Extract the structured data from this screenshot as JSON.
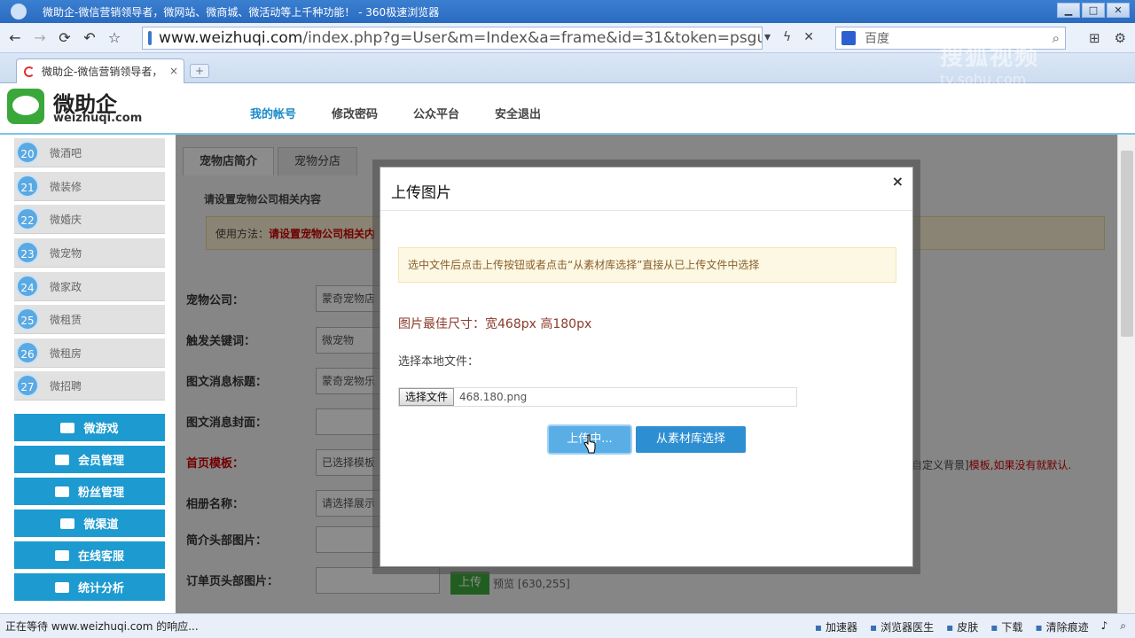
{
  "window": {
    "title": "微助企-微信营销领导者，微网站、微商城、微活动等上千种功能！ - 360极速浏览器"
  },
  "browser": {
    "url_host": "www.weizhuqi.com",
    "url_path": "/index.php?g=User&m=Index&a=frame&id=31&token=psguai1",
    "search_placeholder": "百度",
    "tab_title": "微助企-微信营销领导者，",
    "status_text": "正在等待 www.weizhuqi.com 的响应...",
    "status_tools": [
      "加速器",
      "浏览器医生",
      "皮肤",
      "下载",
      "清除痕迹"
    ],
    "watermark": "搜狐视频",
    "watermark_sub": "tv.sohu.com"
  },
  "header": {
    "logo_title": "微助企",
    "logo_sub": "weizhuqi.com",
    "menu": [
      "我的帐号",
      "修改密码",
      "公众平台",
      "安全退出"
    ]
  },
  "sidebar": {
    "items": [
      {
        "num": "20",
        "label": "微酒吧"
      },
      {
        "num": "21",
        "label": "微装修"
      },
      {
        "num": "22",
        "label": "微婚庆"
      },
      {
        "num": "23",
        "label": "微宠物"
      },
      {
        "num": "24",
        "label": "微家政"
      },
      {
        "num": "25",
        "label": "微租赁"
      },
      {
        "num": "26",
        "label": "微租房"
      },
      {
        "num": "27",
        "label": "微招聘"
      }
    ],
    "buttons": [
      "微游戏",
      "会员管理",
      "粉丝管理",
      "微渠道",
      "在线客服",
      "统计分析"
    ]
  },
  "content": {
    "tabs": [
      "宠物店简介",
      "宠物分店"
    ],
    "subtitle": "请设置宠物公司相关内容",
    "usage_label": "使用方法：",
    "usage_text": "请设置宠物公司相关内",
    "fields": [
      {
        "label": "宠物公司：",
        "value": "蒙奇宠物店"
      },
      {
        "label": "触发关键词：",
        "value": "微宠物"
      },
      {
        "label": "图文消息标题：",
        "value": "蒙奇宠物乐"
      },
      {
        "label": "图文消息封面：",
        "value": ""
      },
      {
        "label": "首页模板：",
        "value": "已选择模板"
      },
      {
        "label": "相册名称：",
        "value": "请选择展示"
      },
      {
        "label": "简介头部图片：",
        "value": ""
      },
      {
        "label": "订单页头部图片：",
        "value": ""
      }
    ],
    "template_hint_a": "自定义背景]",
    "template_hint_b": "模板,如果没有就默认.",
    "upload_label": "上传",
    "preview_text": "预览 [630,255]"
  },
  "modal": {
    "title": "上传图片",
    "close": "×",
    "note": "选中文件后点击上传按钮或者点击“从素材库选择”直接从已上传文件中选择",
    "size_hint": "图片最佳尺寸：宽468px 高180px",
    "local_label": "选择本地文件：",
    "choose_label": "选择文件",
    "file_name": "468.180.png",
    "upload_btn": "上传中...",
    "library_btn": "从素材库选择"
  }
}
